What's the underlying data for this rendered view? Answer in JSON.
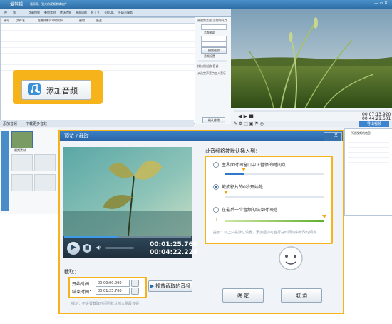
{
  "app": {
    "title_left": "爱剪辑",
    "title_right": "最易用、强大的视频剪辑软件",
    "tabs": [
      "视",
      "频",
      "字幕特效",
      "叠加素材",
      "转场特效",
      "画面风格",
      "M T V",
      "卡拉OK",
      "升级与服务"
    ],
    "list_headers": [
      "序号",
      "文件名",
      "在最终影片中的时间",
      "截取",
      "备注"
    ],
    "side_labels": [
      "原视频音量/当前时间点",
      "音频截取",
      "截取时间",
      "播放截取",
      "音频设置",
      "按比例/当前音调",
      "从选定声音点加入音乐",
      "确认修改"
    ],
    "preview_times": {
      "current": "00:07:13.920",
      "total": "00:44:21.601"
    },
    "export_label": "导出视频",
    "bottom_tools": [
      "添加音频",
      "下载更多音效"
    ],
    "timeline_label": "视频素材",
    "props_title": "所选视频的信息"
  },
  "callout": {
    "button_label": "添加音频"
  },
  "dialog": {
    "title": "预览 / 截取",
    "close_label": "X",
    "section_heading": "此音频将被默认插入到：",
    "options": [
      {
        "label": "主界面时间窗口中正暂停的时间点",
        "selected": false
      },
      {
        "label": "截成影片的0秒开始处",
        "selected": true
      },
      {
        "label": "在最后一个音频的结束时间处",
        "selected": false
      }
    ],
    "tip": "提示：以上只是默认设置，添加后仍可自行在时间线中修改时间点",
    "video_time_current": "00:01:25.760",
    "video_time_total": "00:04:22.224",
    "cut_heading": "截取：",
    "start_label": "开始时间：",
    "start_value": "00:00:00.000",
    "end_label": "结束时间：",
    "end_value": "00:01:25.760",
    "play_cut_label": "播放截取的音频",
    "cut_hint": "提示：不设置截取时间则默认插入整段音频",
    "ok_label": "确 定",
    "cancel_label": "取 消",
    "progress": 0.42
  }
}
